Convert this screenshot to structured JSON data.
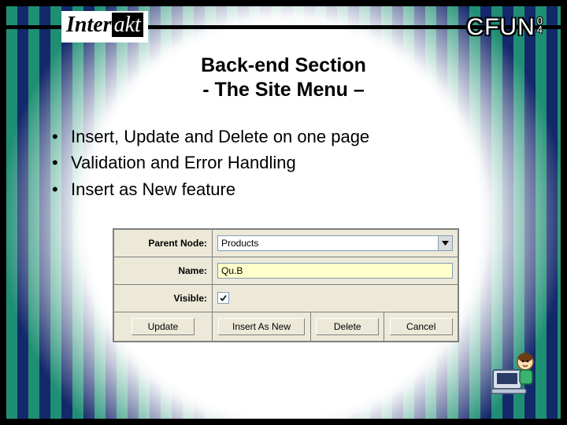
{
  "brand": {
    "interakt_prefix": "Inter",
    "interakt_suffix": "akt",
    "cfun_main": "CFUN",
    "cfun_sup1": "0",
    "cfun_sup2": "4"
  },
  "title": {
    "line1": "Back-end Section",
    "line2": "- The Site Menu –"
  },
  "bullets": [
    "Insert, Update and Delete on one page",
    "Validation and Error Handling",
    "Insert as New feature"
  ],
  "form": {
    "labels": {
      "parent_node": "Parent Node:",
      "name": "Name:",
      "visible": "Visible:"
    },
    "values": {
      "parent_node": "Products",
      "name": "Qu.B",
      "visible": true
    },
    "buttons": {
      "update": "Update",
      "insert_as_new": "Insert As New",
      "delete": "Delete",
      "cancel": "Cancel"
    }
  }
}
